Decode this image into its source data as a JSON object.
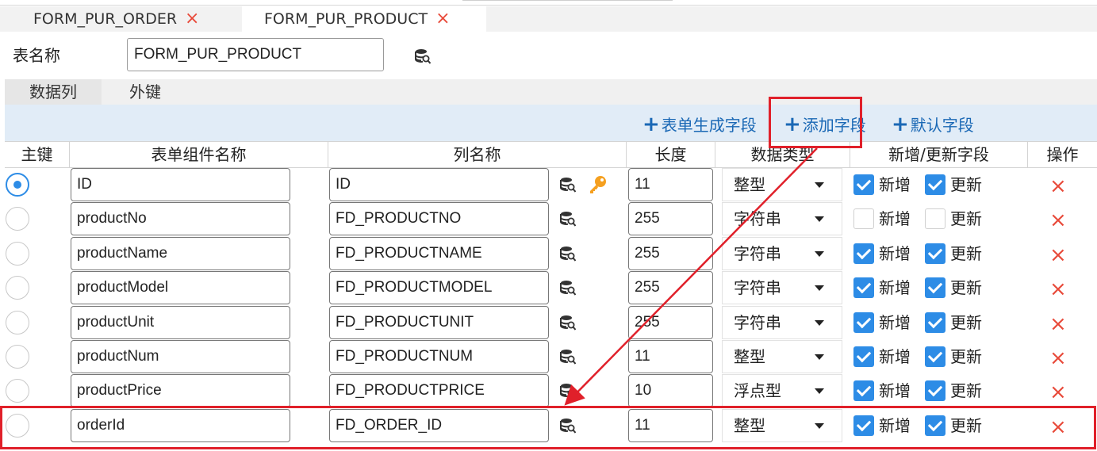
{
  "tabs": [
    {
      "label": "FORM_PUR_ORDER",
      "close": "×"
    },
    {
      "label": "FORM_PUR_PRODUCT",
      "close": "×"
    }
  ],
  "table_name": {
    "label": "表名称",
    "value": "FORM_PUR_PRODUCT"
  },
  "sub_tabs": [
    "数据列",
    "外键"
  ],
  "toolbar": {
    "generate": "表单生成字段",
    "add": "添加字段",
    "default": "默认字段"
  },
  "headers": [
    "主键",
    "表单组件名称",
    "列名称",
    "长度",
    "数据类型",
    "新增/更新字段",
    "操作"
  ],
  "labels": {
    "insert": "新增",
    "update": "更新",
    "delete": "×"
  },
  "rows": [
    {
      "pk": true,
      "comp": "ID",
      "col": "ID",
      "len": "11",
      "type": "整型",
      "insert": true,
      "update": true,
      "key": true
    },
    {
      "pk": false,
      "comp": "productNo",
      "col": "FD_PRODUCTNO",
      "len": "255",
      "type": "字符串",
      "insert": false,
      "update": false,
      "key": false
    },
    {
      "pk": false,
      "comp": "productName",
      "col": "FD_PRODUCTNAME",
      "len": "255",
      "type": "字符串",
      "insert": true,
      "update": true,
      "key": false
    },
    {
      "pk": false,
      "comp": "productModel",
      "col": "FD_PRODUCTMODEL",
      "len": "255",
      "type": "字符串",
      "insert": true,
      "update": true,
      "key": false
    },
    {
      "pk": false,
      "comp": "productUnit",
      "col": "FD_PRODUCTUNIT",
      "len": "255",
      "type": "字符串",
      "insert": true,
      "update": true,
      "key": false
    },
    {
      "pk": false,
      "comp": "productNum",
      "col": "FD_PRODUCTNUM",
      "len": "11",
      "type": "整型",
      "insert": true,
      "update": true,
      "key": false
    },
    {
      "pk": false,
      "comp": "productPrice",
      "col": "FD_PRODUCTPRICE",
      "len": "10",
      "type": "浮点型",
      "insert": true,
      "update": true,
      "key": false
    },
    {
      "pk": false,
      "comp": "orderId",
      "col": "FD_ORDER_ID",
      "len": "11",
      "type": "整型",
      "insert": true,
      "update": true,
      "key": false
    }
  ],
  "colors": {
    "accent": "#2d8ce6",
    "delete": "#e84a3a",
    "annotation": "#e0202a",
    "toolbar_bg": "#e1ecf7",
    "link": "#1a68b5"
  },
  "icons": {
    "db_search": "database-search-icon",
    "key": "key-icon",
    "plus": "plus-icon",
    "close": "close-icon"
  }
}
